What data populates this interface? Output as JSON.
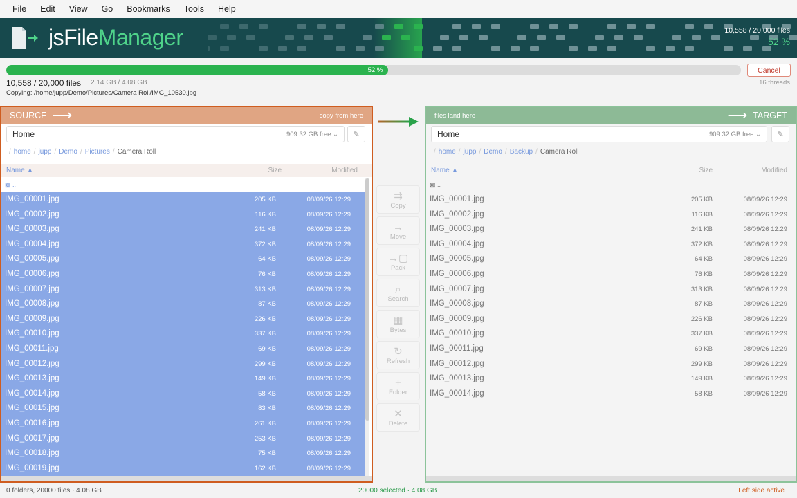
{
  "menu": [
    "File",
    "Edit",
    "View",
    "Go",
    "Bookmarks",
    "Tools",
    "Help"
  ],
  "banner": {
    "brand_a": "jsFile",
    "brand_b": "Manager",
    "files": "10,558 / 20,000  files",
    "pct": "52 %"
  },
  "progress": {
    "value": 0.52,
    "label": "52 %",
    "count": "10,558 / 20,000 files",
    "size": "2.14 GB / 4.08 GB",
    "copying_label": "Copying:",
    "copying_path": "/home/jupp/Demo/Pictures/Camera Roll/IMG_10530.jpg",
    "cancel": "Cancel",
    "threads": "16 threads"
  },
  "source": {
    "title": "SOURCE",
    "hint": "copy from here",
    "location": "Home",
    "free": "909.32 GB free",
    "crumbs": [
      "home",
      "jupp",
      "Demo",
      "Pictures",
      "Camera Roll"
    ],
    "col_name": "Name",
    "col_size": "Size",
    "col_mod": "Modified",
    "updir": "..",
    "files": [
      [
        "IMG_00001.jpg",
        "205 KB",
        "08/09/26 12:29"
      ],
      [
        "IMG_00002.jpg",
        "116 KB",
        "08/09/26 12:29"
      ],
      [
        "IMG_00003.jpg",
        "241 KB",
        "08/09/26 12:29"
      ],
      [
        "IMG_00004.jpg",
        "372 KB",
        "08/09/26 12:29"
      ],
      [
        "IMG_00005.jpg",
        "64 KB",
        "08/09/26 12:29"
      ],
      [
        "IMG_00006.jpg",
        "76 KB",
        "08/09/26 12:29"
      ],
      [
        "IMG_00007.jpg",
        "313 KB",
        "08/09/26 12:29"
      ],
      [
        "IMG_00008.jpg",
        "87 KB",
        "08/09/26 12:29"
      ],
      [
        "IMG_00009.jpg",
        "226 KB",
        "08/09/26 12:29"
      ],
      [
        "IMG_00010.jpg",
        "337 KB",
        "08/09/26 12:29"
      ],
      [
        "IMG_00011.jpg",
        "69 KB",
        "08/09/26 12:29"
      ],
      [
        "IMG_00012.jpg",
        "299 KB",
        "08/09/26 12:29"
      ],
      [
        "IMG_00013.jpg",
        "149 KB",
        "08/09/26 12:29"
      ],
      [
        "IMG_00014.jpg",
        "58 KB",
        "08/09/26 12:29"
      ],
      [
        "IMG_00015.jpg",
        "83 KB",
        "08/09/26 12:29"
      ],
      [
        "IMG_00016.jpg",
        "261 KB",
        "08/09/26 12:29"
      ],
      [
        "IMG_00017.jpg",
        "253 KB",
        "08/09/26 12:29"
      ],
      [
        "IMG_00018.jpg",
        "75 KB",
        "08/09/26 12:29"
      ],
      [
        "IMG_00019.jpg",
        "162 KB",
        "08/09/26 12:29"
      ]
    ]
  },
  "target": {
    "title": "TARGET",
    "hint": "files land here",
    "location": "Home",
    "free": "909.32 GB free",
    "crumbs": [
      "home",
      "jupp",
      "Demo",
      "Backup",
      "Camera Roll"
    ],
    "col_name": "Name",
    "col_size": "Size",
    "col_mod": "Modified",
    "updir": "..",
    "files": [
      [
        "IMG_00001.jpg",
        "205 KB",
        "08/09/26 12:29"
      ],
      [
        "IMG_00002.jpg",
        "116 KB",
        "08/09/26 12:29"
      ],
      [
        "IMG_00003.jpg",
        "241 KB",
        "08/09/26 12:29"
      ],
      [
        "IMG_00004.jpg",
        "372 KB",
        "08/09/26 12:29"
      ],
      [
        "IMG_00005.jpg",
        "64 KB",
        "08/09/26 12:29"
      ],
      [
        "IMG_00006.jpg",
        "76 KB",
        "08/09/26 12:29"
      ],
      [
        "IMG_00007.jpg",
        "313 KB",
        "08/09/26 12:29"
      ],
      [
        "IMG_00008.jpg",
        "87 KB",
        "08/09/26 12:29"
      ],
      [
        "IMG_00009.jpg",
        "226 KB",
        "08/09/26 12:29"
      ],
      [
        "IMG_00010.jpg",
        "337 KB",
        "08/09/26 12:29"
      ],
      [
        "IMG_00011.jpg",
        "69 KB",
        "08/09/26 12:29"
      ],
      [
        "IMG_00012.jpg",
        "299 KB",
        "08/09/26 12:29"
      ],
      [
        "IMG_00013.jpg",
        "149 KB",
        "08/09/26 12:29"
      ],
      [
        "IMG_00014.jpg",
        "58 KB",
        "08/09/26 12:29"
      ]
    ]
  },
  "tools": [
    {
      "label": "Copy",
      "icon": "copy-arrows-icon",
      "glyph": "⇉"
    },
    {
      "label": "Move",
      "icon": "move-arrow-icon",
      "glyph": "→"
    },
    {
      "label": "Pack",
      "icon": "pack-icon",
      "glyph": "→▢"
    },
    {
      "label": "Search",
      "icon": "search-icon",
      "glyph": "⌕"
    },
    {
      "label": "Bytes",
      "icon": "bytes-grid-icon",
      "glyph": "▦"
    },
    {
      "label": "Refresh",
      "icon": "refresh-icon",
      "glyph": "↻"
    },
    {
      "label": "Folder",
      "icon": "new-folder-icon",
      "glyph": "+"
    },
    {
      "label": "Delete",
      "icon": "delete-icon",
      "glyph": "✕"
    }
  ],
  "status": {
    "left": "0 folders, 20000 files  ·  4.08 GB",
    "center": "20000 selected  ·  4.08 GB",
    "right": "Left side active"
  },
  "colors": {
    "source_border": "#cf5d20",
    "target_border": "#8cc39a",
    "accent_green": "#2bb34f",
    "banner": "#17494d"
  }
}
